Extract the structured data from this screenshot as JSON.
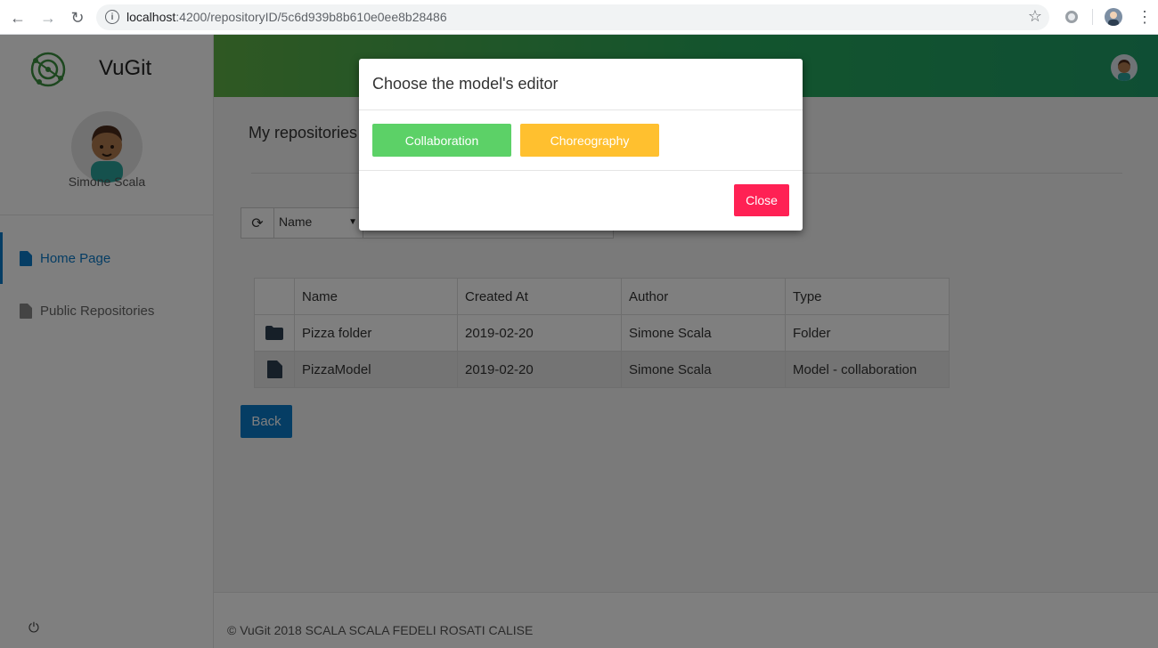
{
  "browser": {
    "url_host": "localhost",
    "url_rest": ":4200/repositoryID/5c6d939b8b610e0ee8b28486",
    "back_icon": "←",
    "forward_icon": "→",
    "reload_icon": "↻",
    "star_icon": "☆",
    "menu_icon": "⋮"
  },
  "app": {
    "brand": "VuGit",
    "user_name": "Simone Scala",
    "accent": "#0b7ac9"
  },
  "sidebar": {
    "items": [
      {
        "label": "Home Page",
        "active": true
      },
      {
        "label": "Public Repositories",
        "active": false
      }
    ],
    "power_icon": "⏻"
  },
  "main": {
    "title": "My repositories",
    "refresh_icon": "⟳",
    "filter_select": "Name",
    "search_icon": "🔍",
    "table": {
      "headers": [
        "",
        "Name",
        "Created At",
        "Author",
        "Type"
      ],
      "rows": [
        {
          "icon": "folder-icon",
          "name": "Pizza folder",
          "created": "2019-02-20",
          "author": "Simone Scala",
          "type": "Folder"
        },
        {
          "icon": "file-icon",
          "name": "PizzaModel",
          "created": "2019-02-20",
          "author": "Simone Scala",
          "type": "Model - collaboration"
        }
      ]
    },
    "back_label": "Back"
  },
  "footer": {
    "text": "© VuGit 2018 SCALA SCALA FEDELI ROSATI CALISE"
  },
  "modal": {
    "title": "Choose the model's editor",
    "collaboration_label": "Collaboration",
    "choreography_label": "Choreography",
    "close_label": "Close",
    "colors": {
      "collaboration": "#5cd167",
      "choreography": "#ffc02f",
      "close": "#ff2154"
    }
  }
}
